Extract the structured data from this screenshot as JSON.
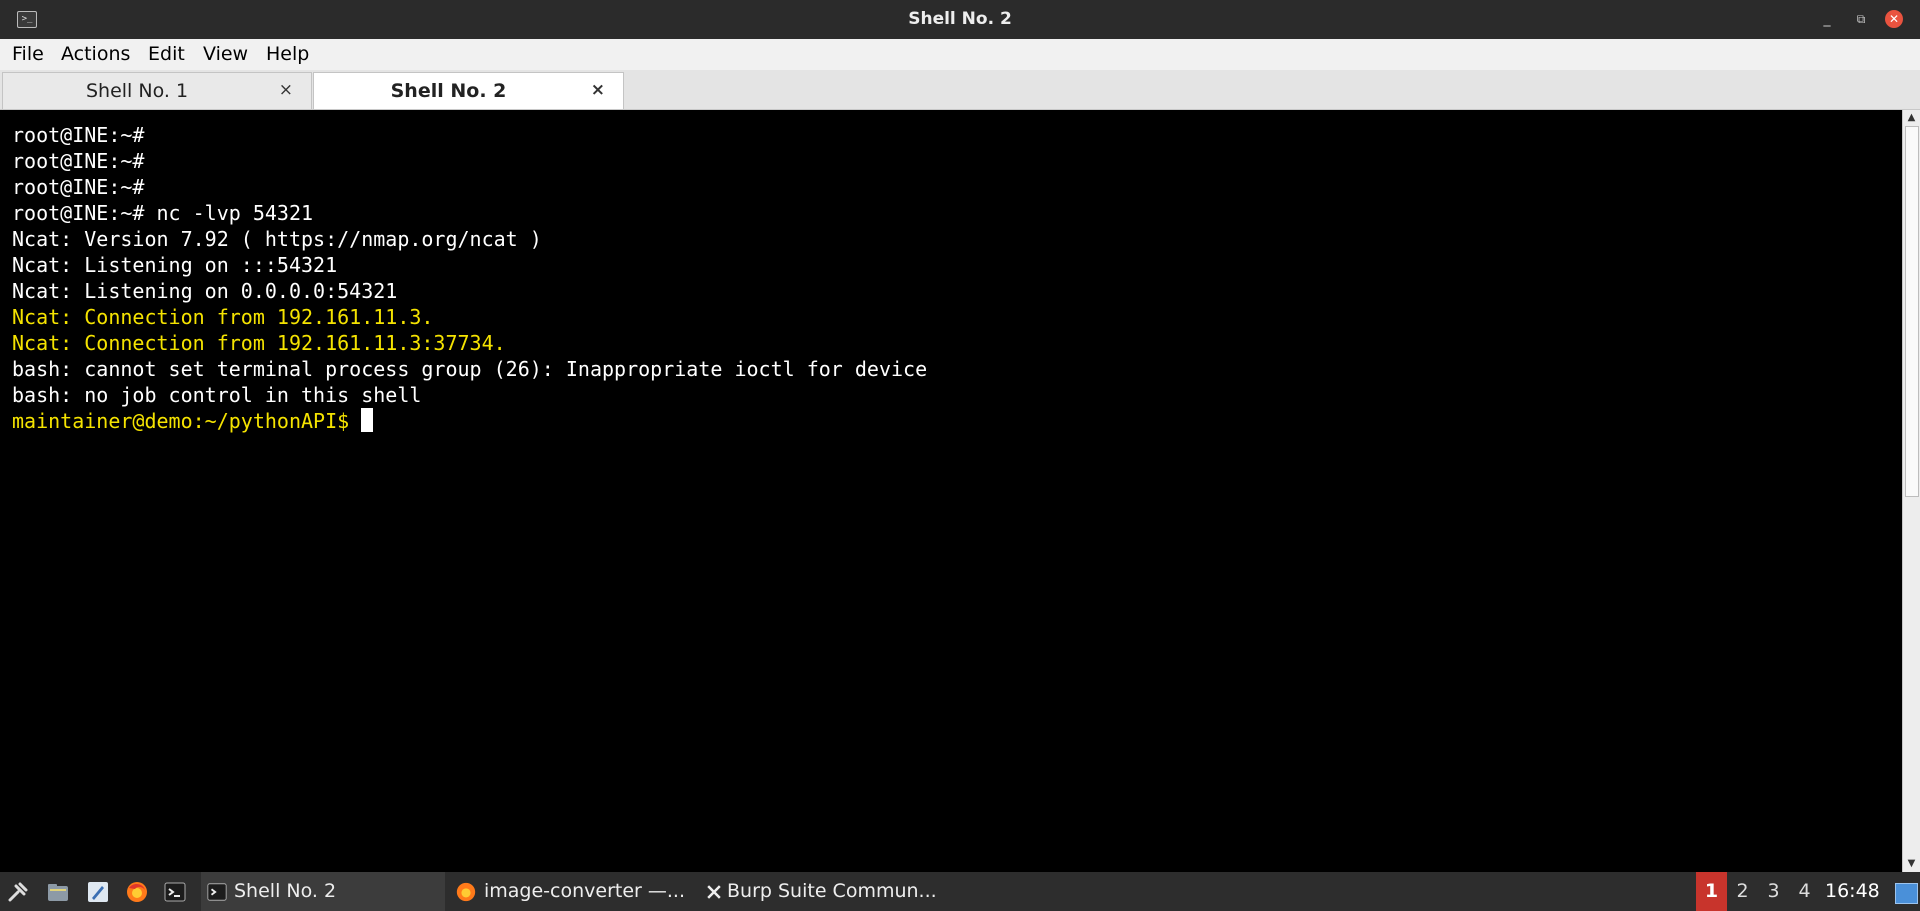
{
  "window": {
    "title": "Shell No. 2",
    "app_icon": "terminal-icon",
    "controls": {
      "minimize": "_",
      "maximize": "⧉",
      "close": "✕"
    }
  },
  "menubar": [
    "File",
    "Actions",
    "Edit",
    "View",
    "Help"
  ],
  "tabs": [
    {
      "label": "Shell No. 1",
      "active": false,
      "close": "×"
    },
    {
      "label": "Shell No. 2",
      "active": true,
      "close": "×"
    }
  ],
  "terminal": {
    "lines": [
      {
        "text": "root@INE:~#",
        "color": "white"
      },
      {
        "text": "root@INE:~#",
        "color": "white"
      },
      {
        "text": "root@INE:~#",
        "color": "white"
      },
      {
        "text": "root@INE:~# nc -lvp 54321",
        "color": "white"
      },
      {
        "text": "Ncat: Version 7.92 ( https://nmap.org/ncat )",
        "color": "white"
      },
      {
        "text": "Ncat: Listening on :::54321",
        "color": "white"
      },
      {
        "text": "Ncat: Listening on 0.0.0.0:54321",
        "color": "white"
      },
      {
        "text": "Ncat: Connection from 192.161.11.3.",
        "color": "yellow"
      },
      {
        "text": "Ncat: Connection from 192.161.11.3:37734.",
        "color": "yellow"
      },
      {
        "text": "bash: cannot set terminal process group (26): Inappropriate ioctl for device",
        "color": "white"
      },
      {
        "text": "bash: no job control in this shell",
        "color": "white"
      }
    ],
    "prompt": "maintainer@demo:~/pythonAPI$"
  },
  "taskbar": {
    "launchers": [
      "applications-menu-icon",
      "file-manager-icon",
      "text-editor-icon",
      "firefox-icon",
      "terminal-icon"
    ],
    "tasks": [
      {
        "label": "Shell No. 2",
        "icon": "terminal-icon",
        "active": true
      },
      {
        "label": "image-converter —...",
        "icon": "firefox-icon",
        "active": false
      },
      {
        "label": "Burp Suite Commun...",
        "icon": "burp-suite-icon",
        "active": false
      }
    ],
    "workspaces": [
      "1",
      "2",
      "3",
      "4"
    ],
    "active_workspace": "1",
    "clock": "16:48"
  },
  "colors": {
    "terminal_bg": "#000000",
    "terminal_fg": "#ffffff",
    "terminal_yellow": "#f5e300",
    "titlebar_bg": "#2b2b2b",
    "taskbar_bg": "#2d2d2d",
    "workspace_active": "#c8342c",
    "close_button": "#e9533f"
  }
}
